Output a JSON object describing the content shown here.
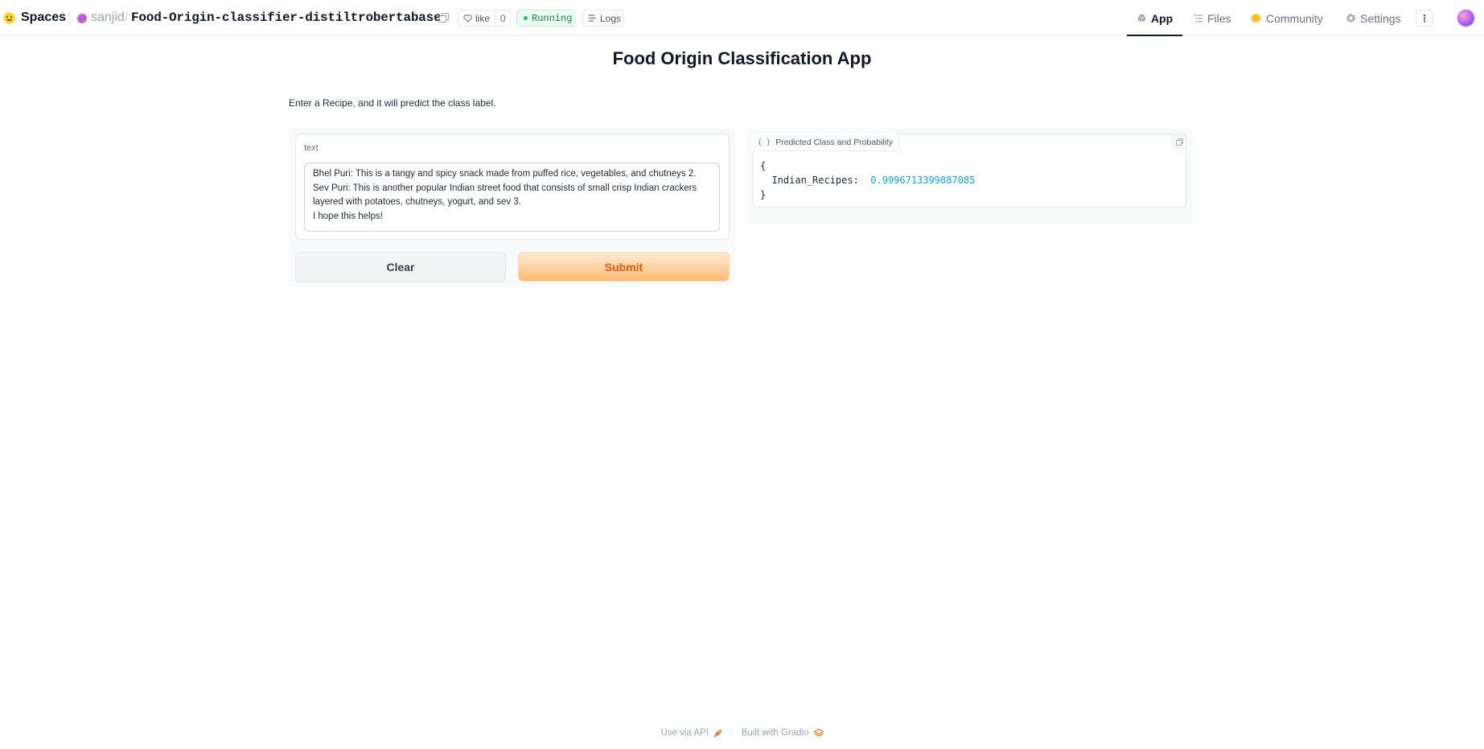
{
  "header": {
    "brand": "Spaces",
    "owner": "sanjid",
    "separator": "/",
    "repo": "Food-Origin-classifier-distiltrobertabase",
    "like_label": "like",
    "like_count": "0",
    "status": "Running",
    "logs_label": "Logs",
    "tabs": [
      {
        "label": "App",
        "icon": "cube-icon",
        "active": true
      },
      {
        "label": "Files",
        "icon": "files-icon",
        "active": false
      },
      {
        "label": "Community",
        "icon": "community-icon",
        "active": false
      },
      {
        "label": "Settings",
        "icon": "gear-icon",
        "active": false
      }
    ],
    "more_icon": "⋮"
  },
  "app": {
    "title": "Food Origin Classification App",
    "description": "Enter a Recipe, and it will predict the class label.",
    "input": {
      "label": "text",
      "value": "Bhel Puri: This is a tangy and spicy snack made from puffed rice, vegetables, and chutneys 2.\nSev Puri: This is another popular Indian street food that consists of small crisp Indian crackers layered with potatoes, chutneys, yogurt, and sev 3.\nI hope this helps!"
    },
    "buttons": {
      "clear": "Clear",
      "submit": "Submit"
    },
    "output": {
      "label": "Predicted Class and Probability",
      "brace_icon": "{ }",
      "open_brace": "{",
      "key": "Indian_Recipes:",
      "value": "0.9996713399887085",
      "close_brace": "}"
    }
  },
  "footer": {
    "api": "Use via API",
    "dot": "·",
    "built": "Built with Gradio"
  },
  "colors": {
    "accent_orange": "#ea580c",
    "running_green": "#15803d",
    "json_value_blue": "#0ea5e9"
  }
}
